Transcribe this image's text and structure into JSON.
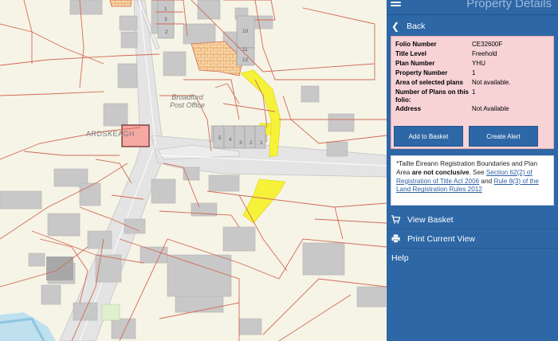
{
  "panel": {
    "title": "Property Details",
    "back_label": "Back",
    "details": [
      {
        "key": "Folio Number",
        "value": "CE32600F"
      },
      {
        "key": "Title Level",
        "value": "Freehold"
      },
      {
        "key": "Plan Number",
        "value": "YHU"
      },
      {
        "key": "Property Number",
        "value": "1"
      },
      {
        "key": "Area of selected plans",
        "value": "Not available."
      },
      {
        "key": "Number of Plans on this folio:",
        "value": "1"
      },
      {
        "key": "Address",
        "value": "Not Available"
      }
    ],
    "add_to_basket_label": "Add to Basket",
    "create_alert_label": "Create Alert",
    "notice": {
      "text1": "*Tailte Éireann Registration Boundaries and Plan Area ",
      "bold": "are not conclusive",
      "text2": ". See ",
      "link1": "Section 62(2) of Registration of Title Act 2006",
      "text3": " and ",
      "link2": "Rule 8(3) of the Land Registration Rules 2012"
    },
    "menu": [
      {
        "label": "View Basket",
        "icon": "cart-icon"
      },
      {
        "label": "Print Current View",
        "icon": "printer-icon"
      },
      {
        "label": "Help",
        "icon": ""
      }
    ]
  },
  "map": {
    "place_name": "ARDSKEAGH",
    "post_office_label": "Broadford Post Office",
    "house_numbers": [
      "1",
      "3",
      "10",
      "11",
      "12",
      "2",
      "1",
      "2",
      "3",
      "4",
      "5"
    ],
    "colors": {
      "road": "#e3e3e3",
      "boundary": "#d26a55",
      "building": "#c9c9c9",
      "highlight": "#f6f23a",
      "selected": "#f4a9a3",
      "panel": "#2e67a6"
    }
  }
}
